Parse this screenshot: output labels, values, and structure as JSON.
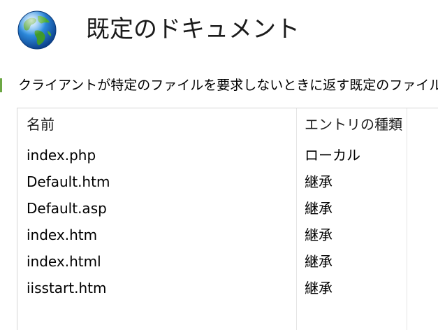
{
  "header": {
    "title": "既定のドキュメント",
    "icon": "globe-icon"
  },
  "description": "クライアントが特定のファイルを要求しないときに返す既定のファイル",
  "table": {
    "columns": [
      "名前",
      "エントリの種類"
    ],
    "rows": [
      {
        "name": "index.php",
        "type": "ローカル"
      },
      {
        "name": "Default.htm",
        "type": "継承"
      },
      {
        "name": "Default.asp",
        "type": "継承"
      },
      {
        "name": "index.htm",
        "type": "継承"
      },
      {
        "name": "index.html",
        "type": "継承"
      },
      {
        "name": "iisstart.htm",
        "type": "継承"
      }
    ]
  },
  "colors": {
    "accent_marker": "#6ca744",
    "border": "#d4d4d4"
  }
}
